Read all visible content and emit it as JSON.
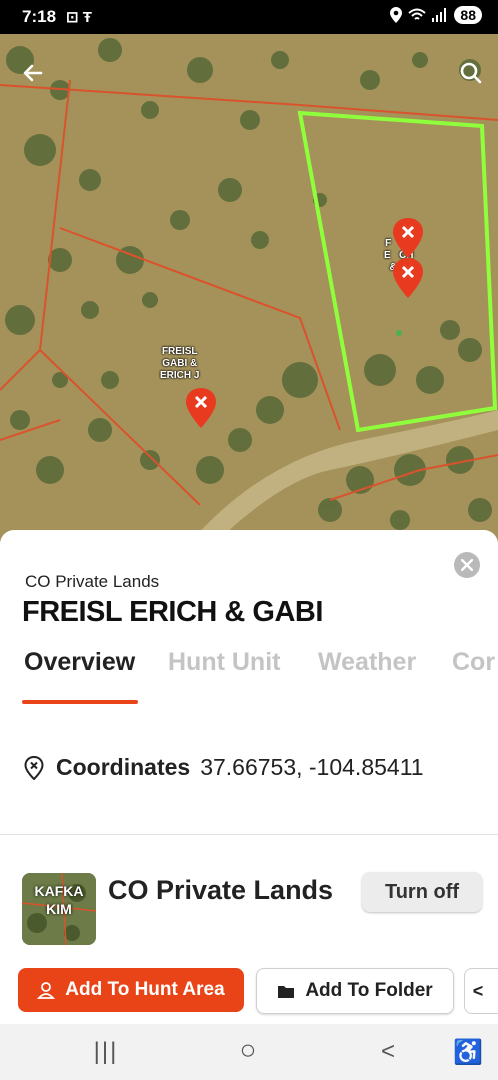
{
  "status_bar": {
    "time": "7:18",
    "left_icons": "⊡ Ŧ",
    "battery": "88"
  },
  "map": {
    "back_icon": "arrow-left-icon",
    "search_icon": "search-icon",
    "labels": [
      {
        "text": "FREISL\nGABI &\nERICH J"
      },
      {
        "text": "F   SL\nE   CH\n&   I"
      }
    ],
    "pin_color": "#e83a1e",
    "selected_border_color": "#8eff3a",
    "boundary_color": "#d9532c"
  },
  "sheet": {
    "layer_name": "CO Private Lands",
    "title": "FREISL ERICH & GABI",
    "tabs": [
      "Overview",
      "Hunt Unit",
      "Weather",
      "Cor"
    ],
    "active_tab": 0,
    "coordinates_label": "Coordinates",
    "coordinates_value": "37.66753, -104.85411",
    "layer": {
      "thumb_text_1": "KAFKA",
      "thumb_text_2": "KIM",
      "name": "CO Private Lands",
      "toggle_label": "Turn off"
    },
    "actions": {
      "add_hunt_area": "Add To Hunt Area",
      "add_folder": "Add To Folder",
      "more_label": "<"
    },
    "accent_color": "#e84418"
  },
  "nav": {
    "recents": "|||",
    "home": "○",
    "back": "<",
    "accessibility": "♿"
  }
}
